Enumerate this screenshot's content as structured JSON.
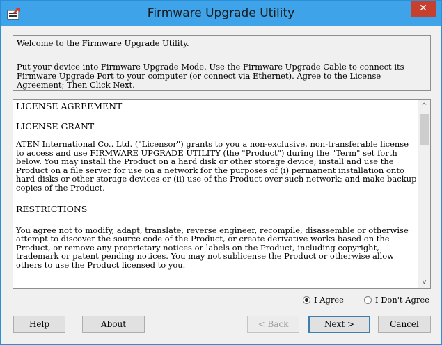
{
  "window": {
    "title": "Firmware Upgrade Utility",
    "close_glyph": "✕"
  },
  "welcome": {
    "line1": "Welcome to the Firmware Upgrade Utility.",
    "line2": "Put your device into Firmware Upgrade Mode. Use the Firmware Upgrade Cable to connect its Firmware Upgrade Port to your computer (or connect via Ethernet). Agree to the License Agreement; Then Click Next."
  },
  "license": {
    "heading": "LICENSE AGREEMENT",
    "grant_heading": "LICENSE GRANT",
    "grant_text": "ATEN International Co., Ltd. (\"Licensor\") grants to you a non-exclusive, non-transferable license to access and use FIRMWARE UPGRADE UTILITY (the \"Product\") during the \"Term\" set forth below. You may install the Product on a hard disk or other storage device; install and use the Product on a file server for use on a network for the purposes of (i) permanent installation onto hard disks or other storage devices or (ii) use of the Product over such network; and make backup copies of the Product.",
    "restrictions_heading": "RESTRICTIONS",
    "restrictions_text": "You agree not to modify, adapt, translate, reverse engineer, recompile, disassemble or otherwise attempt to discover the source code of the Product, or create derivative works based on the Product, or remove any proprietary notices or labels on the Product, including copyright, trademark or patent pending notices. You may not sublicense the Product or otherwise allow others to use the Product licensed to you."
  },
  "scrollbar": {
    "up_glyph": "^",
    "down_glyph": "v"
  },
  "agreement": {
    "agree_label": "I Agree",
    "disagree_label": "I Don't Agree",
    "selected": "agree"
  },
  "buttons": {
    "help": "Help",
    "about": "About",
    "back": "< Back",
    "next": "Next >",
    "cancel": "Cancel"
  },
  "colors": {
    "titlebar": "#3ea3e8",
    "close_button": "#c7402f",
    "default_button_border": "#3c7fb1"
  },
  "icons": {
    "app_icon": "firmware-upgrade-app-icon",
    "close": "close-icon"
  }
}
